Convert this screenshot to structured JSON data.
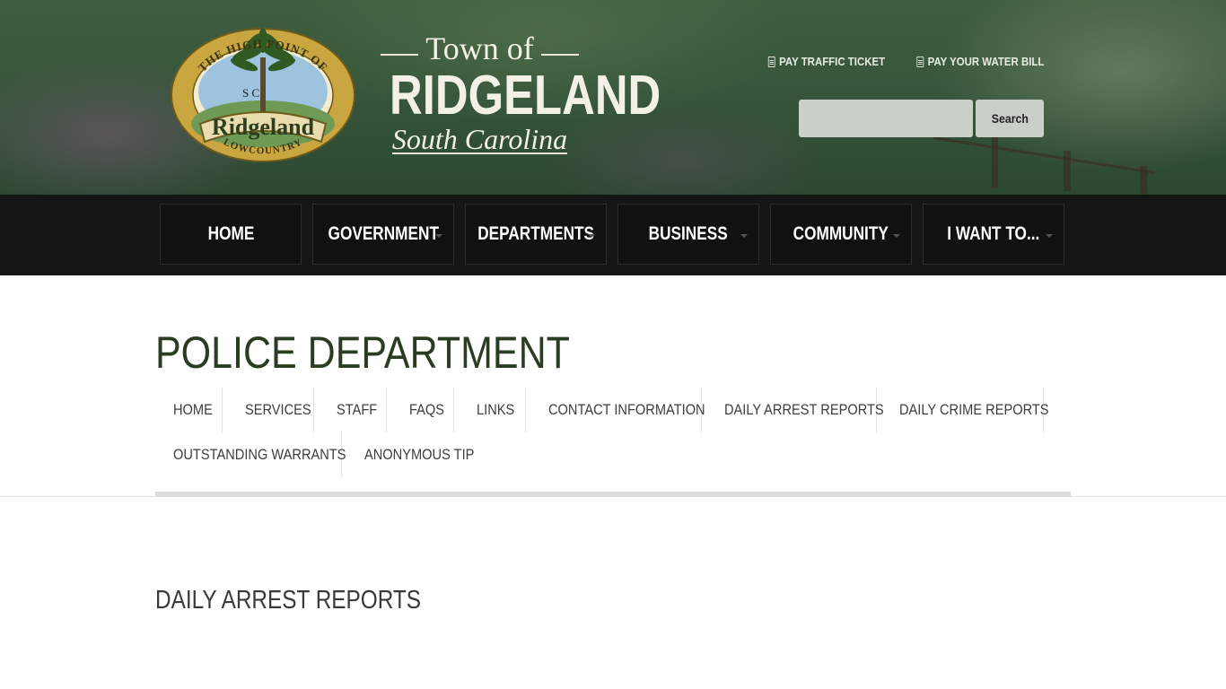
{
  "header": {
    "logo": {
      "seal_top_text": "THE HIGH POINT OF",
      "seal_initials": "S C",
      "seal_ribbon": "Ridgeland",
      "seal_bottom_text": "LOWCOUNTRY",
      "town_of": "Town of",
      "name": "RIDGELAND",
      "state": "South Carolina"
    },
    "quick_links": [
      {
        "label": "PAY TRAFFIC TICKET",
        "icon": "document-icon"
      },
      {
        "label": "PAY YOUR WATER BILL",
        "icon": "document-icon"
      }
    ],
    "search": {
      "placeholder": "",
      "value": "",
      "button_label": "Search"
    }
  },
  "main_nav": [
    {
      "label": "HOME",
      "has_dropdown": false
    },
    {
      "label": "GOVERNMENT",
      "has_dropdown": true
    },
    {
      "label": "DEPARTMENTS",
      "has_dropdown": true
    },
    {
      "label": "BUSINESS",
      "has_dropdown": true
    },
    {
      "label": "COMMUNITY",
      "has_dropdown": true
    },
    {
      "label": "I WANT TO...",
      "has_dropdown": true
    }
  ],
  "page": {
    "title": "POLICE DEPARTMENT",
    "sub_nav": [
      "HOME",
      "SERVICES",
      "STAFF",
      "FAQS",
      "LINKS",
      "CONTACT INFORMATION",
      "DAILY ARREST REPORTS",
      "DAILY CRIME REPORTS",
      "OUTSTANDING WARRANTS",
      "ANONYMOUS TIP"
    ],
    "section_heading": "DAILY ARREST REPORTS"
  },
  "colors": {
    "header_green": "#34533a",
    "nav_bg": "#151515",
    "nav_item_bg": "#111111",
    "title_green": "#2a3c22",
    "search_field": "#c9d0c7",
    "seal_gold": "#c9a640"
  }
}
